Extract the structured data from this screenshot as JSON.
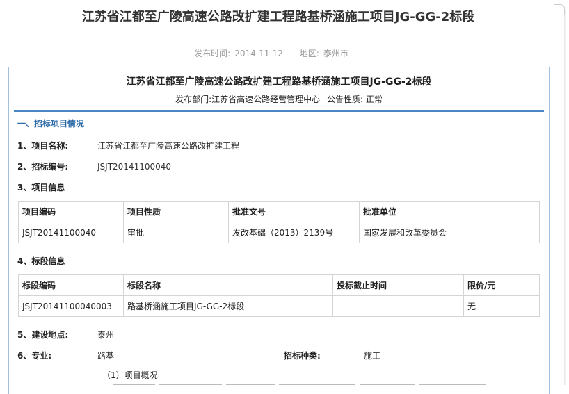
{
  "page": {
    "title": "江苏省江都至广陵高速公路改扩建工程路基桥涵施工项目JG-GG-2标段",
    "meta": {
      "date_label": "发布时间:",
      "date_value": "2014-11-12",
      "region_label": "地区:",
      "region_value": "泰州市"
    }
  },
  "notice": {
    "title": "江苏省江都至广陵高速公路改扩建工程路基桥涵施工项目JG-GG-2标段",
    "dept_label": "发布部门:",
    "dept_value": "江苏省高速公路经营管理中心",
    "nature_label": "公告性质:",
    "nature_value": "正常"
  },
  "section1": {
    "heading": "一、招标项目情况",
    "project_name_label": "1、项目名称:",
    "project_name_value": "江苏省江都至广陵高速公路改扩建工程",
    "bid_no_label": "2、招标编号:",
    "bid_no_value": "JSJT20141100040",
    "project_info_label": "3、项目信息",
    "project_table": {
      "headers": [
        "项目编码",
        "项目性质",
        "批准文号",
        "批准单位"
      ],
      "rows": [
        [
          "JSJT20141100040",
          "审批",
          "发改基础（2013）2139号",
          "国家发展和改革委员会"
        ]
      ]
    },
    "section_info_label": "4、标段信息",
    "section_table": {
      "headers": [
        "标段编码",
        "标段名称",
        "投标截止时间",
        "限价/元"
      ],
      "rows": [
        [
          "JSJT20141100040003",
          "路基桥涵施工项目JG-GG-2标段",
          "",
          "无"
        ]
      ]
    },
    "location_label": "5、建设地点:",
    "location_value": "泰州",
    "specialty_label": "6、专业:",
    "specialty_value": "路基",
    "bid_type_label": "招标种类:",
    "bid_type_value": "施工",
    "overview_label": "（1）项目概况"
  },
  "colors": {
    "accent_blue": "#2c6aa8",
    "rule_blue": "#4a86c5",
    "box_border": "#9fc1de"
  }
}
